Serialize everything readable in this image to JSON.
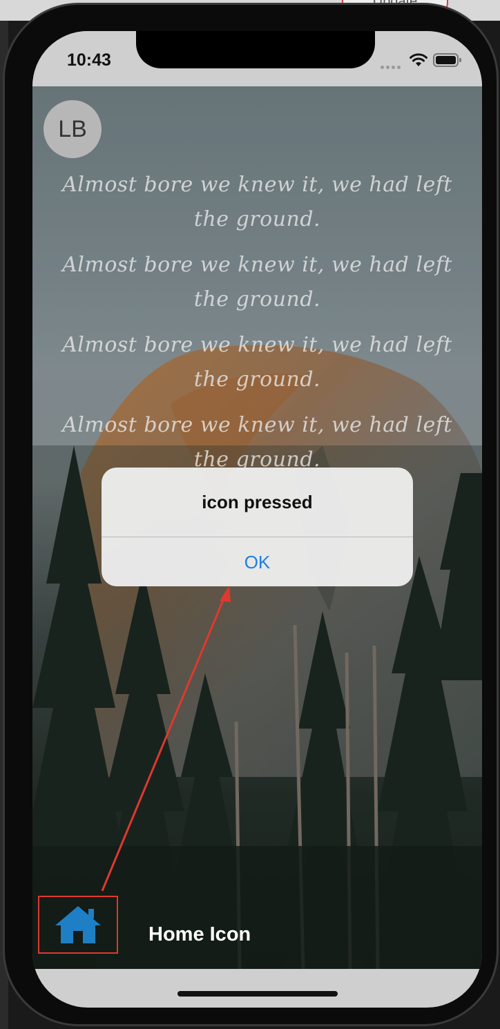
{
  "status_bar": {
    "time": "10:43"
  },
  "browser_chrome": {
    "update_label": "Update"
  },
  "avatar": {
    "initials": "LB"
  },
  "quotes": [
    "Almost bore we knew it, we had left the ground.",
    "Almost bore we knew it, we had left the ground.",
    "Almost bore we knew it, we had left the ground.",
    "Almost bore we knew it, we had left the ground."
  ],
  "alert": {
    "title": "icon pressed",
    "ok_label": "OK"
  },
  "home": {
    "icon": "home-icon",
    "label": "Home Icon",
    "icon_color": "#1f7fc4"
  },
  "annotation_color": "#e0382e"
}
